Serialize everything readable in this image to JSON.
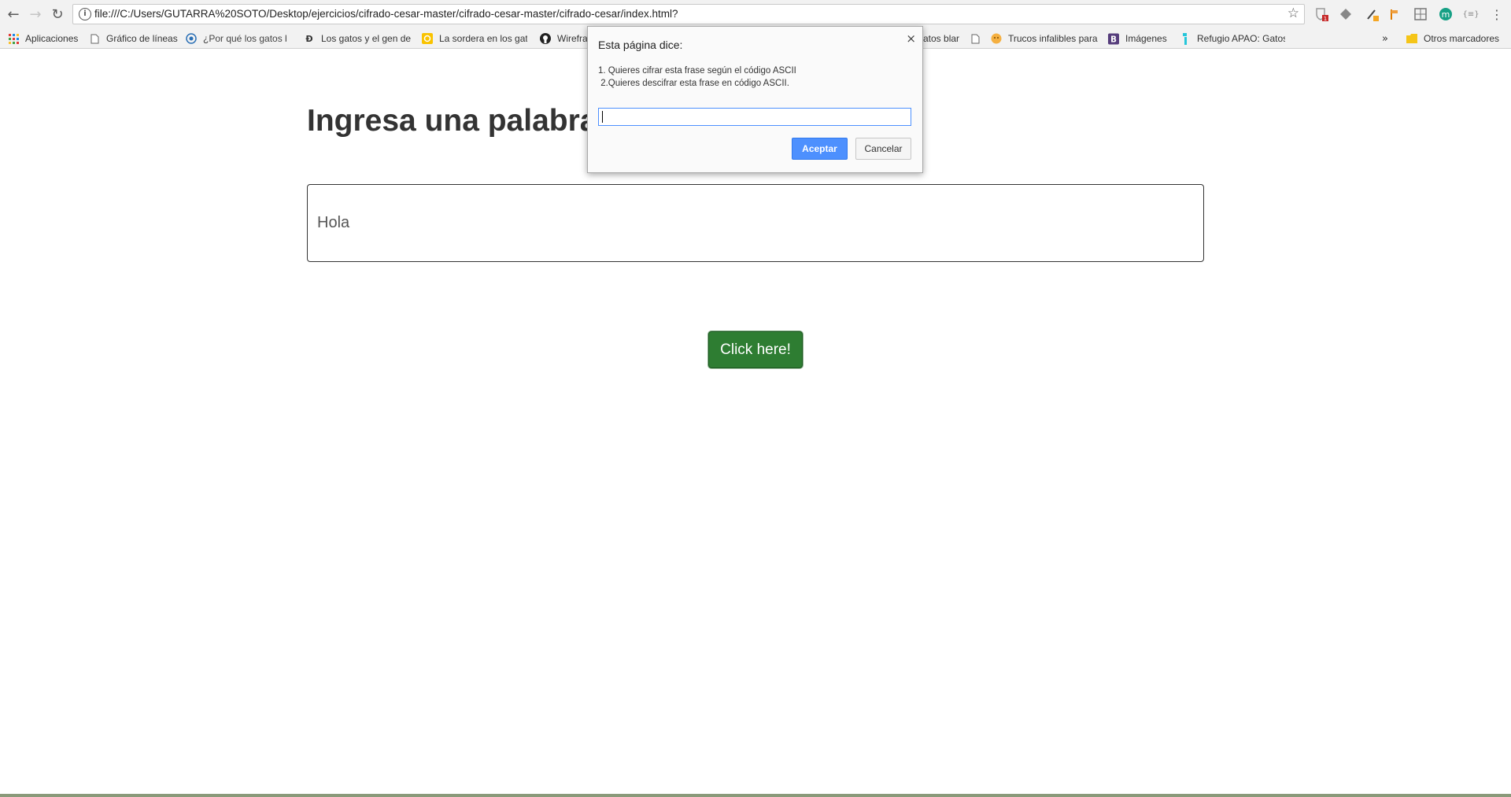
{
  "browser": {
    "url": "file:///C:/Users/GUTARRA%20SOTO/Desktop/ejercicios/cifrado-cesar-master/cifrado-cesar-master/cifrado-cesar/index.html?",
    "back_icon": "←",
    "forward_icon": "→",
    "reload_icon": "↻",
    "info_icon": "i",
    "star_icon": "☆",
    "extensions": [
      {
        "icon": "shield-badge-icon",
        "badge": "1"
      },
      {
        "icon": "diamond-icon"
      },
      {
        "icon": "pen-icon"
      },
      {
        "icon": "flag-icon"
      },
      {
        "icon": "puzzle-icon"
      },
      {
        "icon": "m-icon",
        "glyph": "m"
      },
      {
        "icon": "brackets-icon",
        "glyph": "{≡}"
      },
      {
        "icon": "menu-icon",
        "glyph": "⋮"
      }
    ]
  },
  "bookmarks": {
    "apps_label": "Aplicaciones",
    "items": [
      {
        "label": "Gráfico de líneas",
        "icon": "page-icon"
      },
      {
        "label": "¿Por qué los gatos bl",
        "icon": "swirl-icon"
      },
      {
        "label": "Los gatos y el gen de",
        "icon": "d-icon"
      },
      {
        "label": "La sordera en los gat",
        "icon": "yellow-icon"
      },
      {
        "label": "Wirefra",
        "icon": "github-icon"
      },
      {
        "label": "atos blar",
        "icon": ""
      },
      {
        "label": "",
        "icon": "page-icon"
      },
      {
        "label": "Trucos infalibles para",
        "icon": "orange-icon"
      },
      {
        "label": "Imágenes",
        "icon": "b-icon"
      },
      {
        "label": "Refugio APAO: Gatos",
        "icon": "cyan-icon"
      }
    ],
    "overflow": "»",
    "other_label": "Otros marcadores"
  },
  "page": {
    "heading": "Ingresa una palabra",
    "input_value": "Hola",
    "button_label": "Click here!"
  },
  "dialog": {
    "title": "Esta página dice:",
    "close": "×",
    "message": "1. Quieres cifrar esta frase según el código ASCII\n 2.Quieres descifrar esta frase en código ASCII.",
    "input_value": "",
    "ok_label": "Aceptar",
    "cancel_label": "Cancelar"
  },
  "colors": {
    "button_green": "#2e7d32",
    "dialog_ok_blue": "#4d90fe"
  }
}
